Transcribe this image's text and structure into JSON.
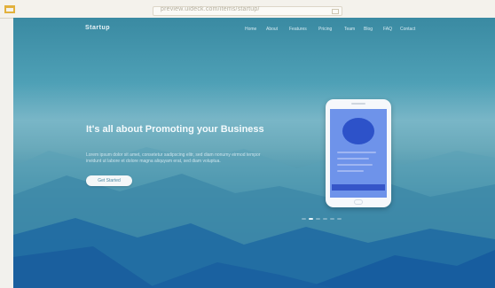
{
  "browser": {
    "url": "preview.uideck.com/items/startup/"
  },
  "nav": {
    "brand": "Startup",
    "items": [
      "Home",
      "About",
      "Features",
      "Pricing",
      "Team",
      "Blog",
      "FAQ",
      "Contact"
    ]
  },
  "hero": {
    "title": "It's all about Promoting your Business",
    "text": "Lorem ipsum dolor sit amet, consetetur sadipscing elitr, sed diam nonumy eirmod tempor invidunt ut labore et dolore magna aliquyam erat, sed diam voluptua.",
    "button_label": "Get Started"
  },
  "slider": {
    "slide_count": 6,
    "active_slide": 1
  },
  "colors": {
    "hero_top": "#3a8aa2",
    "hero_bottom": "#14599c",
    "phone_screen": "#6e93ea",
    "phone_accent": "#2d52c9"
  }
}
